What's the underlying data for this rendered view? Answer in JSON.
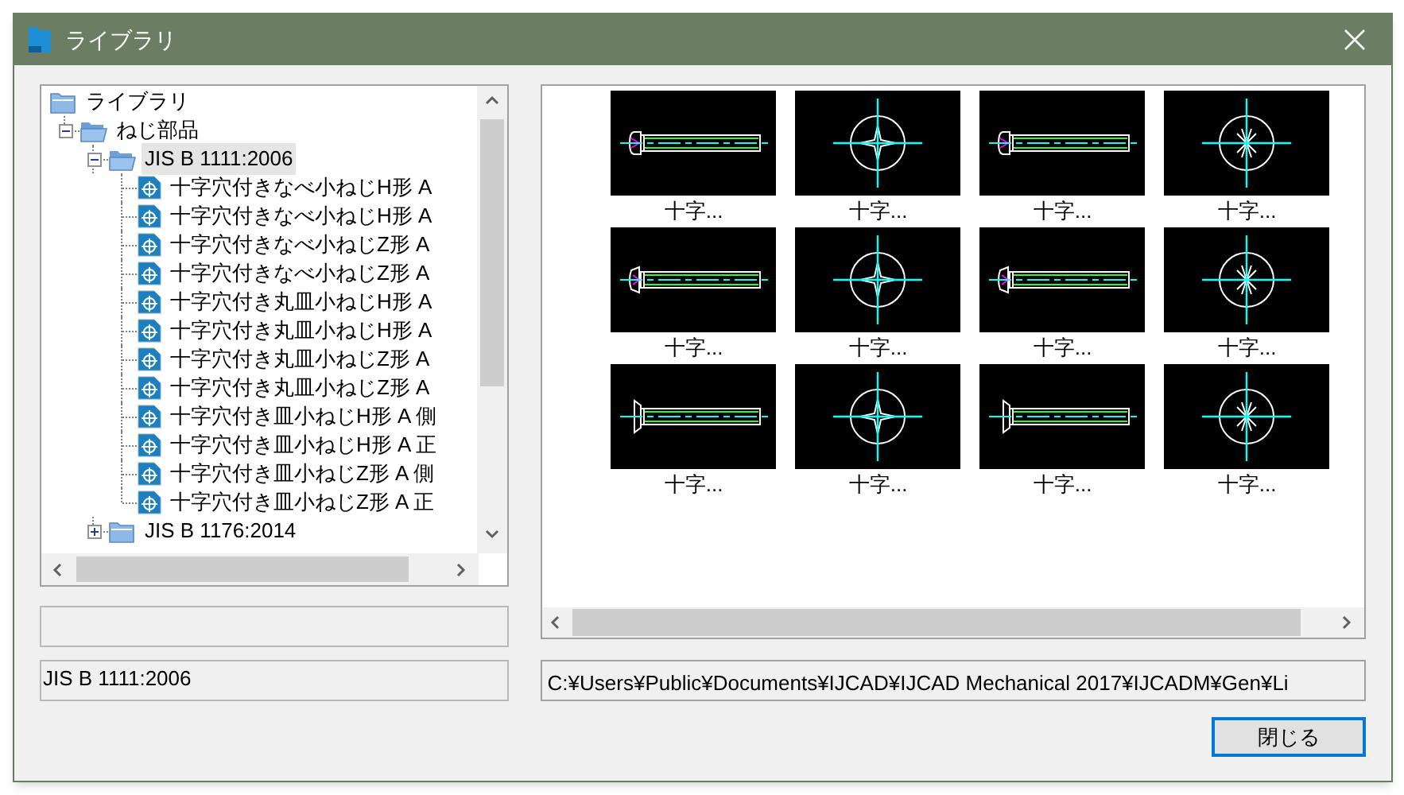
{
  "window": {
    "title": "ライブラリ"
  },
  "tree": [
    {
      "label": "ライブラリ",
      "kind": "root",
      "selected": false,
      "children": [
        {
          "label": "ねじ部品",
          "kind": "folder",
          "expanded": true,
          "selected": false,
          "children": [
            {
              "label": "JIS B 1111:2006",
              "kind": "folder",
              "expanded": true,
              "selected": true,
              "children": [
                {
                  "label": "十字穴付きなべ小ねじH形 A",
                  "kind": "item",
                  "selected": false
                },
                {
                  "label": "十字穴付きなべ小ねじH形 A",
                  "kind": "item",
                  "selected": false
                },
                {
                  "label": "十字穴付きなべ小ねじZ形 A",
                  "kind": "item",
                  "selected": false
                },
                {
                  "label": "十字穴付きなべ小ねじZ形 A",
                  "kind": "item",
                  "selected": false
                },
                {
                  "label": "十字穴付き丸皿小ねじH形 A",
                  "kind": "item",
                  "selected": false
                },
                {
                  "label": "十字穴付き丸皿小ねじH形 A",
                  "kind": "item",
                  "selected": false
                },
                {
                  "label": "十字穴付き丸皿小ねじZ形 A",
                  "kind": "item",
                  "selected": false
                },
                {
                  "label": "十字穴付き丸皿小ねじZ形 A",
                  "kind": "item",
                  "selected": false
                },
                {
                  "label": "十字穴付き皿小ねじH形 A 側",
                  "kind": "item",
                  "selected": false
                },
                {
                  "label": "十字穴付き皿小ねじH形 A 正",
                  "kind": "item",
                  "selected": false
                },
                {
                  "label": "十字穴付き皿小ねじZ形 A 側",
                  "kind": "item",
                  "selected": false
                },
                {
                  "label": "十字穴付き皿小ねじZ形 A 正",
                  "kind": "item",
                  "selected": false
                }
              ]
            },
            {
              "label": "JIS B 1176:2014",
              "kind": "folder",
              "expanded": false,
              "selected": false
            }
          ]
        }
      ]
    }
  ],
  "thumbnails": [
    {
      "label": "十字...",
      "kind": "side-pan"
    },
    {
      "label": "十字...",
      "kind": "front-cross"
    },
    {
      "label": "十字...",
      "kind": "side-pan"
    },
    {
      "label": "十字...",
      "kind": "front-star"
    },
    {
      "label": "十字...",
      "kind": "side-oval"
    },
    {
      "label": "十字...",
      "kind": "front-cross"
    },
    {
      "label": "十字...",
      "kind": "side-oval"
    },
    {
      "label": "十字...",
      "kind": "front-star"
    },
    {
      "label": "十字...",
      "kind": "side-flat"
    },
    {
      "label": "十字...",
      "kind": "front-cross"
    },
    {
      "label": "十字...",
      "kind": "side-flat"
    },
    {
      "label": "十字...",
      "kind": "front-star"
    }
  ],
  "selected_name": "JIS B 1111:2006",
  "folder_path": "C:¥Users¥Public¥Documents¥IJCAD¥IJCAD Mechanical 2017¥IJCADM¥Gen¥Li",
  "buttons": [
    "閉じる"
  ]
}
